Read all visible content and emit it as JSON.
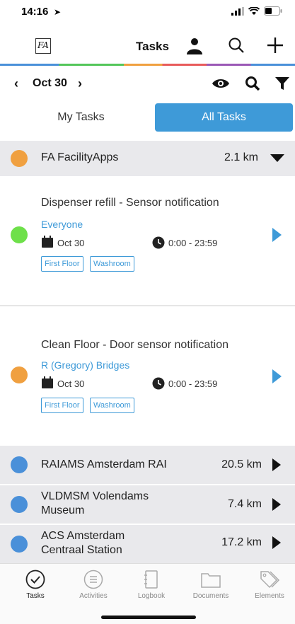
{
  "status_bar": {
    "time": "14:16"
  },
  "app_bar": {
    "logo_text": "FA",
    "title": "Tasks"
  },
  "date_bar": {
    "date": "Oct 30",
    "prev_symbol": "‹",
    "next_symbol": "›"
  },
  "segments": {
    "my_tasks": "My Tasks",
    "all_tasks": "All Tasks",
    "selected": "All Tasks"
  },
  "groups": [
    {
      "name": "FA FacilityApps",
      "distance": "2.1 km",
      "color": "#f0a040",
      "expanded": true
    },
    {
      "name": "RAIAMS Amsterdam RAI",
      "distance": "20.5 km",
      "color": "#4a90d9",
      "expanded": false
    },
    {
      "name_line1": "VLDMSM Volendams",
      "name_line2": "Museum",
      "distance": "7.4 km",
      "color": "#4a90d9",
      "expanded": false
    },
    {
      "name_line1": "ACS Amsterdam",
      "name_line2": "Centraal Station",
      "distance": "17.2 km",
      "color": "#4a90d9",
      "expanded": false
    }
  ],
  "tasks": [
    {
      "title": "Dispenser refill - Sensor notification",
      "assignee": "Everyone",
      "date": "Oct 30",
      "time": "0:00 - 23:59",
      "tags": [
        "First Floor",
        "Washroom"
      ],
      "status_color": "#6ee04a"
    },
    {
      "title": "Clean Floor - Door sensor notification",
      "assignee": "R (Gregory) Bridges",
      "date": "Oct 30",
      "time": "0:00 - 23:59",
      "tags": [
        "First Floor",
        "Washroom"
      ],
      "status_color": "#f0a040"
    }
  ],
  "tabs": [
    {
      "label": "Tasks",
      "icon": "check-circle-icon",
      "active": true
    },
    {
      "label": "Activities",
      "icon": "list-icon",
      "active": false
    },
    {
      "label": "Logbook",
      "icon": "notebook-icon",
      "active": false
    },
    {
      "label": "Documents",
      "icon": "folder-icon",
      "active": false
    },
    {
      "label": "Elements",
      "icon": "tags-icon",
      "active": false
    }
  ],
  "colors": {
    "accent": "#3e9ad8",
    "group_bg": "#e9e9ec"
  }
}
